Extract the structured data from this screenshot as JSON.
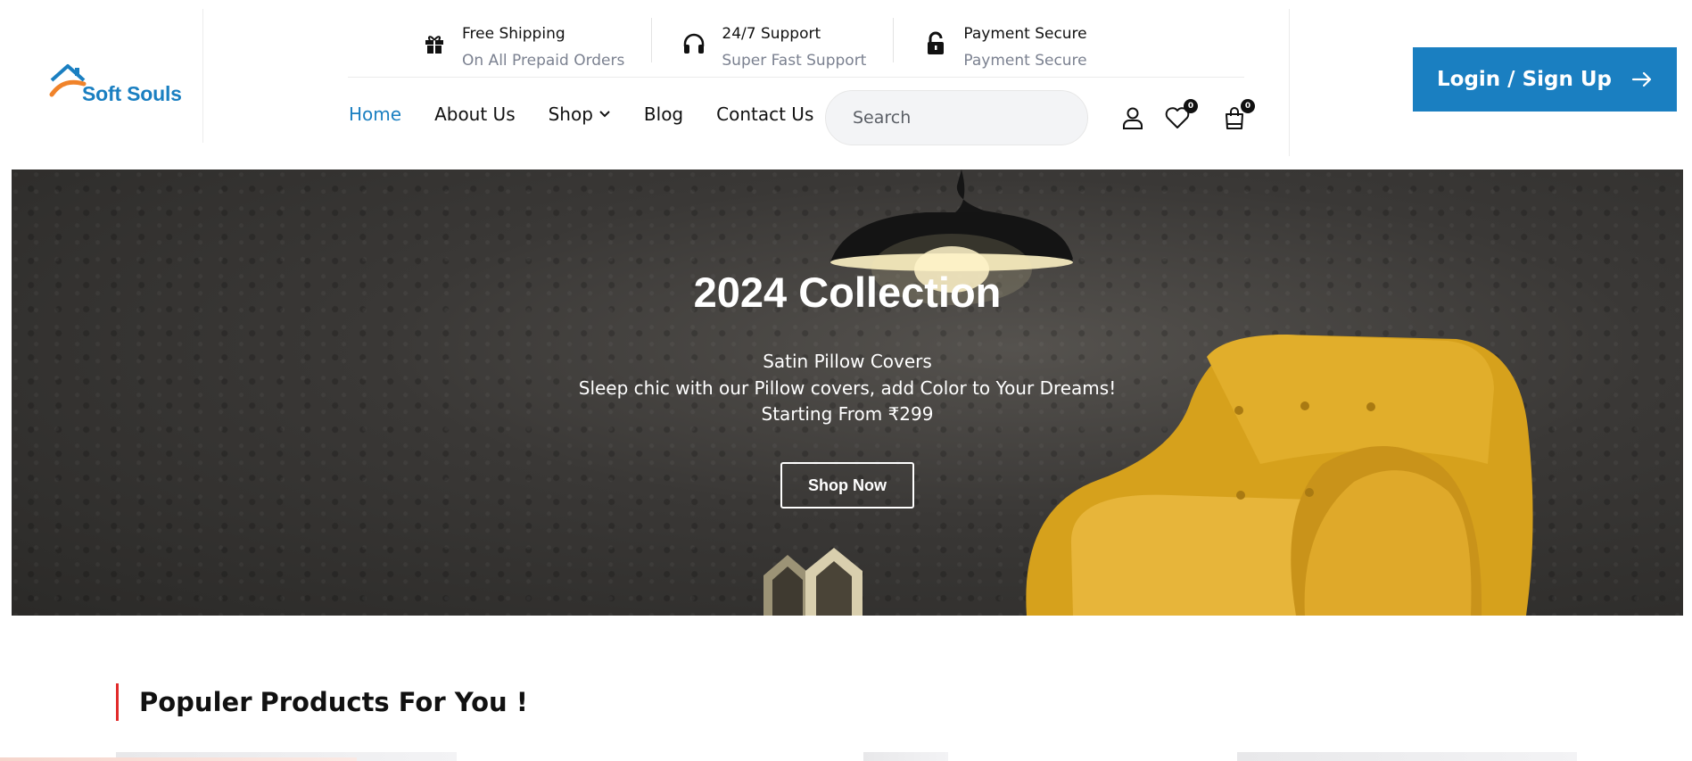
{
  "brand": {
    "name": "Soft Souls",
    "colors": {
      "primary": "#1a7fc1",
      "accent": "#f0832a",
      "highlight": "#e12a2a"
    }
  },
  "features": [
    {
      "icon": "gift-icon",
      "title": "Free Shipping",
      "subtitle": "On All Prepaid Orders"
    },
    {
      "icon": "headphones-icon",
      "title": "24/7 Support",
      "subtitle": "Super Fast Support"
    },
    {
      "icon": "unlock-icon",
      "title": "Payment Secure",
      "subtitle": "Payment Secure"
    }
  ],
  "nav": [
    {
      "label": "Home",
      "active": true
    },
    {
      "label": "About Us"
    },
    {
      "label": "Shop",
      "has_dropdown": true
    },
    {
      "label": "Blog"
    },
    {
      "label": "Contact Us"
    }
  ],
  "search": {
    "placeholder": "Search"
  },
  "header_icons": {
    "wishlist_count": "0",
    "cart_count": "0"
  },
  "login": {
    "label": "Login / Sign Up"
  },
  "hero": {
    "title": "2024 Collection",
    "line1": "Satin Pillow Covers",
    "line2": "Sleep chic with our Pillow covers, add Color to Your Dreams!",
    "line3": "Starting From ₹299",
    "cta": "Shop Now"
  },
  "section": {
    "title_bold": "Populer",
    "title_rest": "Products For You !"
  }
}
